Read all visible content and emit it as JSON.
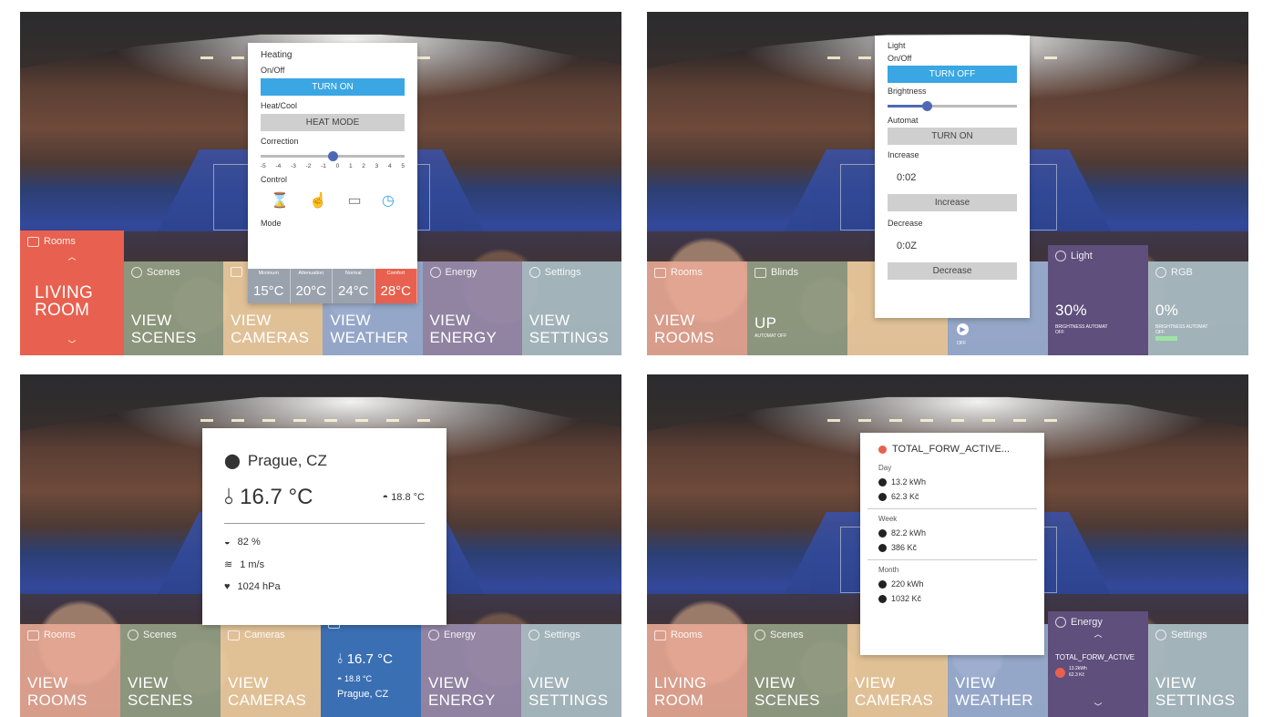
{
  "heating_panel": {
    "popup": {
      "title": "Heating",
      "onoff_label": "On/Off",
      "onoff_button": "TURN ON",
      "heatcool_label": "Heat/Cool",
      "heatcool_button": "HEAT MODE",
      "correction_label": "Correction",
      "correction_value": 0,
      "correction_scale": [
        "-5",
        "-4",
        "-3",
        "-2",
        "-1",
        "0",
        "1",
        "2",
        "3",
        "4",
        "5"
      ],
      "control_label": "Control",
      "mode_label": "Mode",
      "modes": [
        {
          "name": "Minimum",
          "temp": "15°C"
        },
        {
          "name": "Attenuation",
          "temp": "20°C"
        },
        {
          "name": "Normal",
          "temp": "24°C"
        },
        {
          "name": "Comfort",
          "temp": "28°C"
        }
      ]
    },
    "tiles": [
      {
        "head": "Rooms",
        "body": "LIVING ROOM"
      },
      {
        "head": "Scenes",
        "body": "VIEW SCENES"
      },
      {
        "head": "",
        "body": "VIEW CAMERAS"
      },
      {
        "head": "",
        "body": "VIEW WEATHER"
      },
      {
        "head": "Energy",
        "body": "VIEW ENERGY"
      },
      {
        "head": "Settings",
        "body": "VIEW SETTINGS"
      }
    ]
  },
  "light_panel": {
    "popup": {
      "title": "Light",
      "onoff_label": "On/Off",
      "onoff_button": "TURN OFF",
      "brightness_label": "Brightness",
      "brightness_value": 0.3,
      "automat_label": "Automat",
      "automat_button": "TURN ON",
      "increase_label": "Increase",
      "increase_value": "0:02",
      "increase_button": "Increase",
      "decrease_label": "Decrease",
      "decrease_value": "0:0Z",
      "decrease_button": "Decrease"
    },
    "tiles": [
      {
        "head": "Rooms",
        "body": "VIEW ROOMS",
        "sub": ""
      },
      {
        "head": "Blinds",
        "body": "UP",
        "sub": "AUTOMAT OFF"
      },
      {
        "head": "",
        "body": "",
        "sub": ""
      },
      {
        "head": "",
        "body": "",
        "sub": "OFF"
      },
      {
        "head": "Light",
        "body": "30%",
        "sub": "BRIGHTNESS AUTOMAT OFF"
      },
      {
        "head": "RGB",
        "body": "0%",
        "sub": "BRIGHTNESS AUTOMAT OFF"
      }
    ]
  },
  "weather_panel": {
    "popup": {
      "location": "Prague, CZ",
      "temperature": "16.7 °C",
      "feels_like": "18.8 °C",
      "humidity": "82 %",
      "wind": "1 m/s",
      "pressure": "1024 hPa"
    },
    "tiles": [
      {
        "head": "Rooms",
        "body": "VIEW ROOMS"
      },
      {
        "head": "Scenes",
        "body": "VIEW SCENES"
      },
      {
        "head": "Cameras",
        "body": "VIEW CAMERAS"
      },
      {
        "head": "",
        "body": "16.7 °C",
        "sub1": "18.8 °C",
        "sub2": "Prague, CZ"
      },
      {
        "head": "Energy",
        "body": "VIEW ENERGY"
      },
      {
        "head": "Settings",
        "body": "VIEW SETTINGS"
      }
    ]
  },
  "energy_panel": {
    "popup": {
      "title": "TOTAL_FORW_ACTIVE...",
      "day_label": "Day",
      "day_kwh": "13.2 kWh",
      "day_cost": "62.3 Kč",
      "week_label": "Week",
      "week_kwh": "82.2 kWh",
      "week_cost": "386 Kč",
      "month_label": "Month",
      "month_kwh": "220 kWh",
      "month_cost": "1032 Kč"
    },
    "tiles": [
      {
        "head": "Rooms",
        "body": "LIVING ROOM"
      },
      {
        "head": "Scenes",
        "body": "VIEW SCENES"
      },
      {
        "head": "",
        "body": "VIEW CAMERAS"
      },
      {
        "head": "",
        "body": "VIEW WEATHER"
      },
      {
        "head": "Energy",
        "body": "TOTAL_FORW_ACTIVE",
        "sub1": "13.2kWh",
        "sub2": "62.3 Kč"
      },
      {
        "head": "Settings",
        "body": "VIEW SETTINGS"
      }
    ]
  },
  "colors": {
    "accent_blue": "#3aa6e3",
    "active_red": "#e8604f",
    "weather_tile": "#3a6fb3",
    "energy_tile": "#5e4f7c"
  }
}
